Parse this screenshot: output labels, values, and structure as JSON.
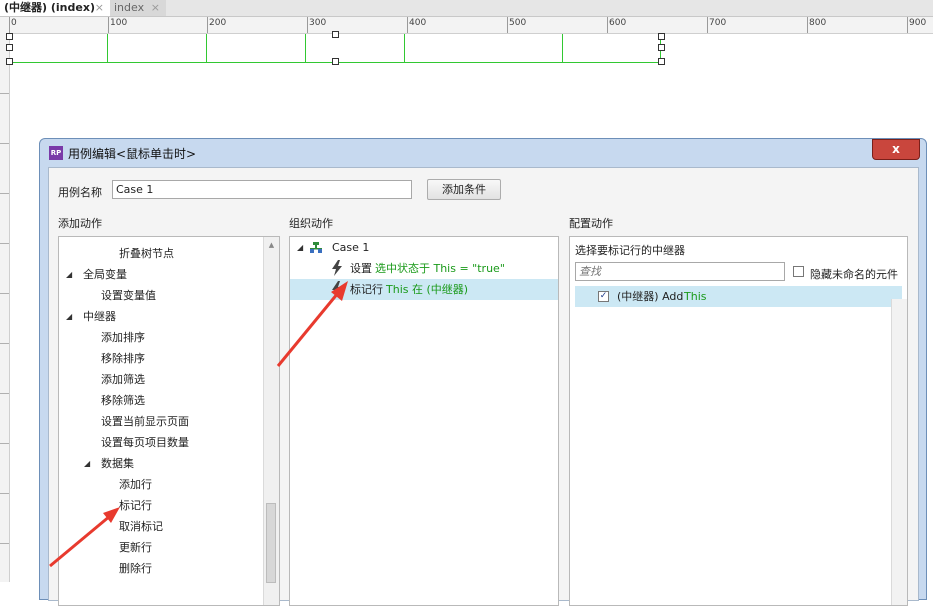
{
  "tabs": [
    {
      "label": "(中继器) (index)",
      "close": "×"
    },
    {
      "label": "index",
      "close": "×"
    }
  ],
  "ruler": {
    "labels": [
      "0",
      "100",
      "200",
      "300",
      "400",
      "500",
      "600",
      "700",
      "800",
      "900"
    ]
  },
  "dialog": {
    "title": "用例编辑<鼠标单击时>",
    "close": "x",
    "case_name_label": "用例名称",
    "case_name_value": "Case 1",
    "add_condition": "添加条件",
    "add_actions_title": "添加动作",
    "organize_actions_title": "组织动作",
    "configure_actions_title": "配置动作"
  },
  "add_actions": {
    "items": [
      {
        "label": "折叠树节点",
        "arrow": ""
      },
      {
        "label": "全局变量",
        "arrow": "◢"
      },
      {
        "label": "设置变量值",
        "arrow": ""
      },
      {
        "label": "中继器",
        "arrow": "◢"
      },
      {
        "label": "添加排序",
        "arrow": ""
      },
      {
        "label": "移除排序",
        "arrow": ""
      },
      {
        "label": "添加筛选",
        "arrow": ""
      },
      {
        "label": "移除筛选",
        "arrow": ""
      },
      {
        "label": "设置当前显示页面",
        "arrow": ""
      },
      {
        "label": "设置每页项目数量",
        "arrow": ""
      },
      {
        "label": "数据集",
        "arrow": "◢"
      },
      {
        "label": "添加行",
        "arrow": ""
      },
      {
        "label": "标记行",
        "arrow": ""
      },
      {
        "label": "取消标记",
        "arrow": ""
      },
      {
        "label": "更新行",
        "arrow": ""
      },
      {
        "label": "删除行",
        "arrow": ""
      }
    ]
  },
  "organize": {
    "case_label": "Case 1",
    "case_arrow": "◢",
    "action1_prefix": "设置",
    "action1_detail": "选中状态于 This = \"true\"",
    "action2_prefix": "标记行",
    "action2_detail": "This 在 (中继器)"
  },
  "configure": {
    "select_label": "选择要标记行的中继器",
    "search_placeholder": "查找",
    "hide_unnamed_label": "隐藏未命名的元件",
    "repeater_item_label": "(中继器) Add",
    "repeater_item_this": "This",
    "repeater_checked": "✓"
  },
  "colors": {
    "accent_green": "#1a9a1a",
    "selection": "#cce8f4",
    "arrow_red": "#e83a2e",
    "repeater_outline": "#32c832"
  },
  "icons": [
    "close-icon",
    "rp-logo-icon",
    "tree-expand-icon",
    "case-icon",
    "lightning-icon",
    "checkbox-icon",
    "scroll-up-icon"
  ]
}
